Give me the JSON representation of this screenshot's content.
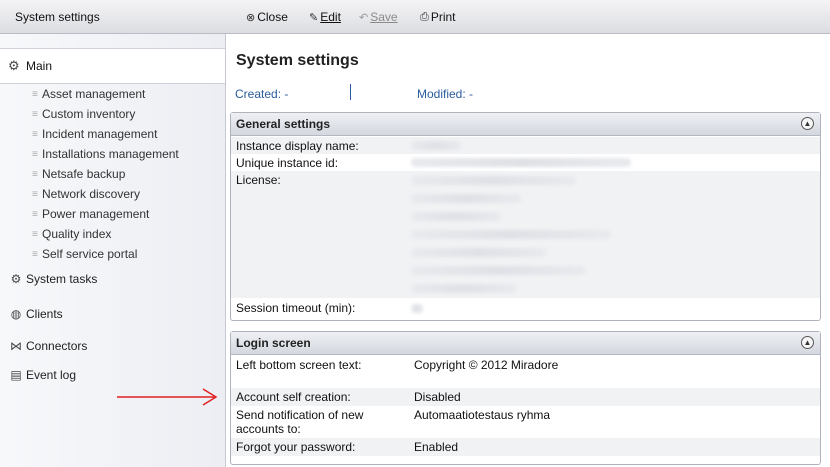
{
  "topbar": {
    "title": "System settings",
    "buttons": [
      {
        "label": "Close",
        "icon": "close-icon",
        "enabled": true
      },
      {
        "label": "Edit",
        "icon": "pencil-icon",
        "enabled": true
      },
      {
        "label": "Save",
        "icon": "save-icon",
        "enabled": false
      },
      {
        "label": "Print",
        "icon": "print-icon",
        "enabled": true
      }
    ]
  },
  "sidebar": {
    "main": {
      "label": "Main",
      "icon": "gears-icon"
    },
    "subitems": [
      "Asset management",
      "Custom inventory",
      "Incident management",
      "Installations management",
      "Netsafe backup",
      "Network discovery",
      "Power management",
      "Quality index",
      "Self service portal"
    ],
    "items": [
      {
        "label": "System tasks",
        "icon": "gear-tasks-icon"
      },
      {
        "label": "Clients",
        "icon": "clients-icon"
      },
      {
        "label": "Connectors",
        "icon": "connectors-icon"
      },
      {
        "label": "Event log",
        "icon": "event-log-icon"
      }
    ]
  },
  "main": {
    "title": "System settings",
    "created": "Created: -",
    "modified": "Modified: -"
  },
  "general": {
    "title": "General settings",
    "rows": {
      "display_name": "Instance display name:",
      "unique_id": "Unique instance id:",
      "license": "License:",
      "session_timeout": "Session timeout (min):"
    }
  },
  "login": {
    "title": "Login screen",
    "rows": [
      {
        "key": "Left bottom screen text:",
        "value": "Copyright © 2012 Miradore"
      },
      {
        "key": "Account self creation:",
        "value": "Disabled"
      },
      {
        "key": "Send notification of new",
        "key2": "accounts to:",
        "value": "Automaatiotestaus ryhma"
      },
      {
        "key": "Forgot your password:",
        "value": "Enabled"
      }
    ]
  },
  "colors": {
    "accent_link": "#2a5d9b",
    "arrow": "#e02020"
  }
}
